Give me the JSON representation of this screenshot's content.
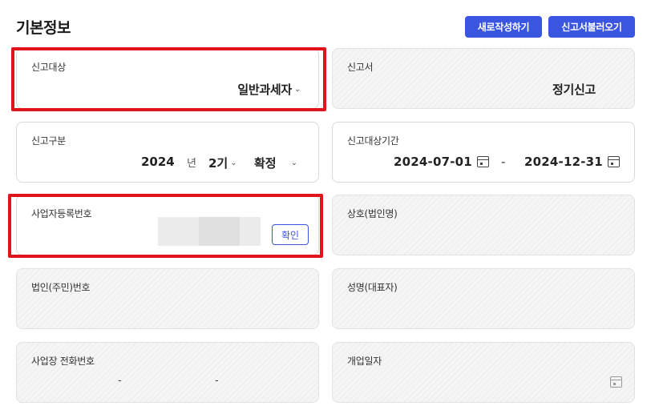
{
  "section": {
    "title": "기본정보"
  },
  "buttons": {
    "new_report": "새로작성하기",
    "load_report": "신고서불러오기"
  },
  "fields": {
    "target": {
      "label": "신고대상",
      "value": "일반과세자"
    },
    "report": {
      "label": "신고서",
      "value": "정기신고"
    },
    "category": {
      "label": "신고구분",
      "year": "2024",
      "year_unit": "년",
      "period": "2기",
      "type": "확정"
    },
    "period": {
      "label": "신고대상기간",
      "start": "2024-07-01",
      "separator": "-",
      "end": "2024-12-31"
    },
    "brn": {
      "label": "사업자등록번호",
      "confirm": "확인"
    },
    "company": {
      "label": "상호(법인명)"
    },
    "corp_no": {
      "label": "법인(주민)번호"
    },
    "ceo": {
      "label": "성명(대표자)"
    },
    "phone": {
      "label": "사업장 전화번호",
      "sep1": "-",
      "sep2": "-"
    },
    "open_date": {
      "label": "개업일자"
    }
  },
  "icons": {
    "chevron": "chevron-down-icon",
    "calendar": "calendar-icon"
  },
  "colors": {
    "primary": "#3a55e0",
    "highlight": "#e0151b"
  }
}
